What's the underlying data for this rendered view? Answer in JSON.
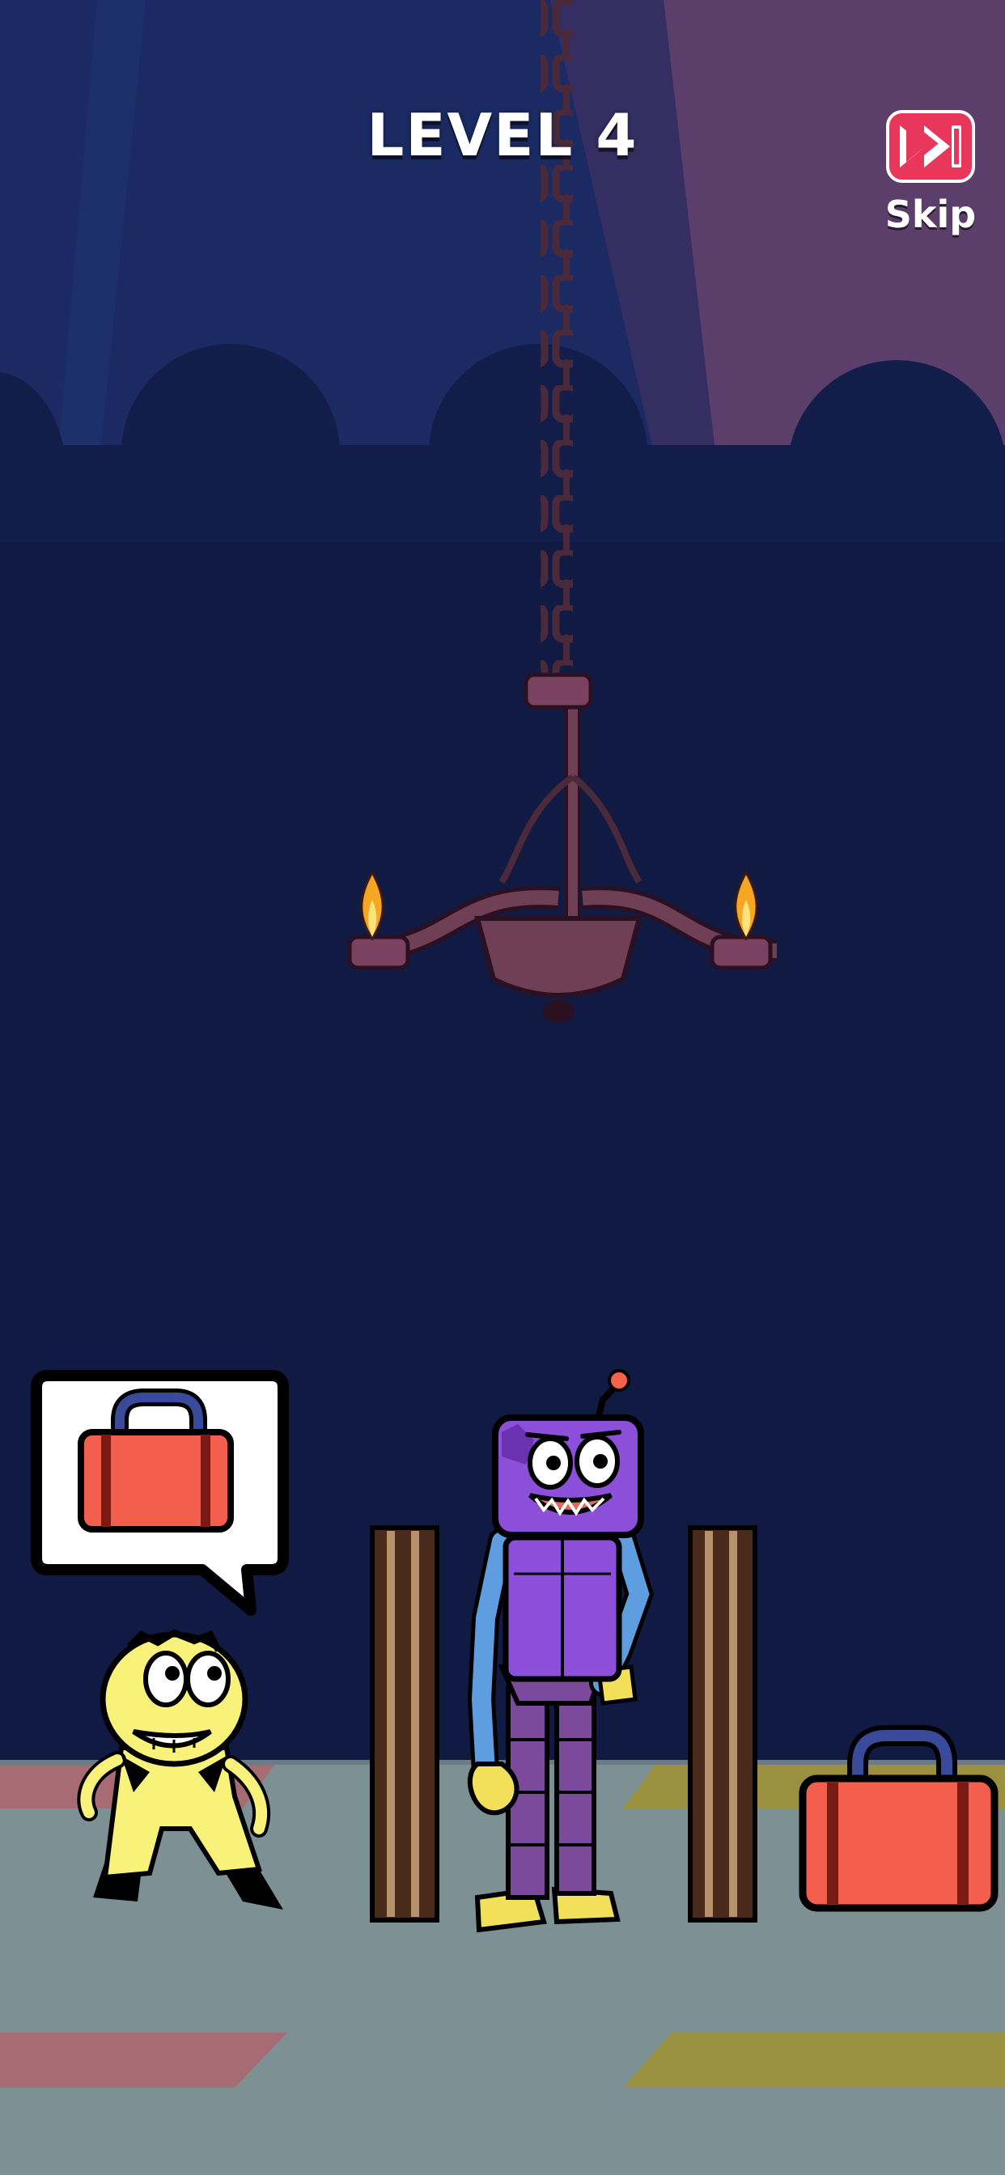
{
  "header": {
    "level_title": "LEVEL 4",
    "skip_label": "Skip",
    "skip_icon": "fast-forward-icon"
  },
  "colors": {
    "sky": "#1b2a63",
    "wall": "#0f1a40",
    "floor": "#7d9094",
    "skip_accent": "#e8375a",
    "suitcase": "#f45e4c",
    "robot": "#8b4fd9",
    "hero": "#f8f27a"
  },
  "scene": {
    "objects": [
      "chandelier",
      "hero-character",
      "speech-bubble-suitcase",
      "wooden-post-left",
      "robot-guard",
      "wooden-post-right",
      "red-suitcase"
    ]
  }
}
